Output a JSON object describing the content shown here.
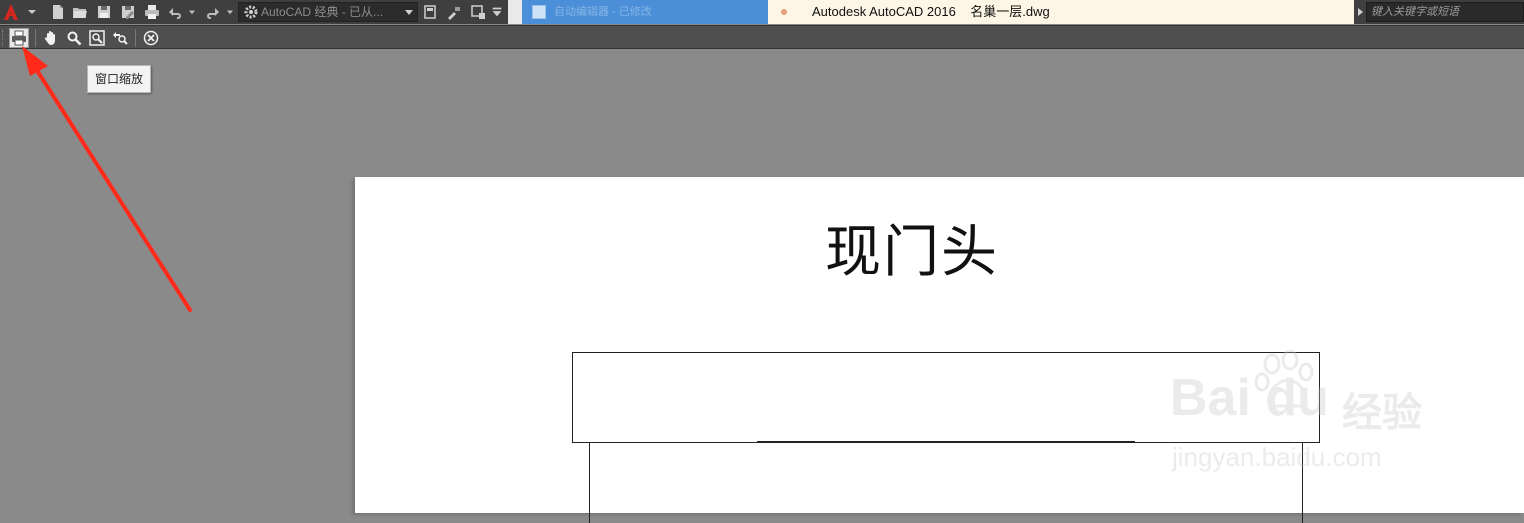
{
  "titlebar": {
    "workspace_label": "AutoCAD 经典 - 已从...",
    "inactive_tab_text": "自动编辑器 - 已修改",
    "window_title": "Autodesk AutoCAD 2016    名巢一层.dwg",
    "search_placeholder": "键入关键字或短语"
  },
  "toolbar": {
    "buttons": [
      "print",
      "pan",
      "zoom",
      "zoom-window",
      "zoom-previous",
      "close-preview"
    ],
    "tooltip": "窗口缩放"
  },
  "drawing": {
    "title": "现门头"
  },
  "watermark": {
    "logo": "Bai du",
    "cn": "经验",
    "url": "jingyan.baidu.com"
  },
  "colors": {
    "accent_red": "#ff2a1a",
    "tab_blue": "#4a8fd8",
    "canvas_gray": "#8a8a8a"
  }
}
